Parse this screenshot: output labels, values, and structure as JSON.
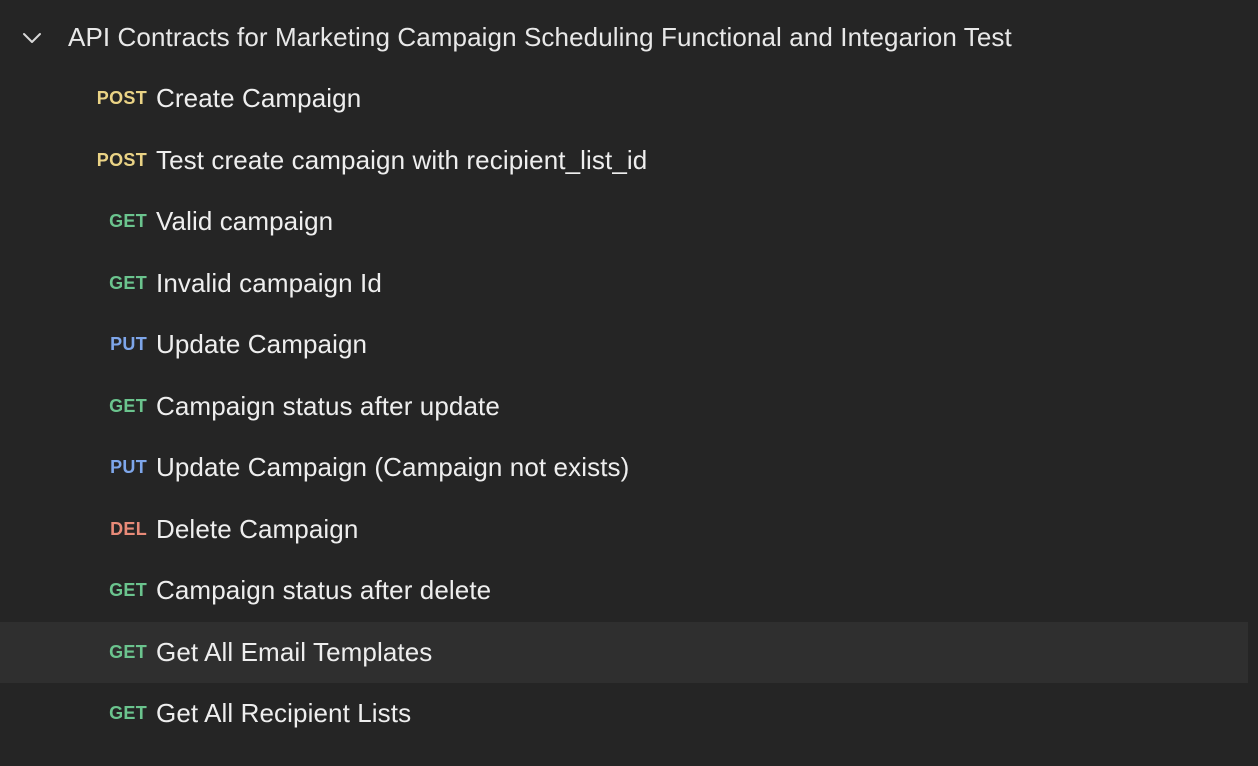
{
  "folder": {
    "title": "API Contracts for Marketing Campaign Scheduling Functional and Integarion Test",
    "expanded": true,
    "chevron_icon": "chevron-down-icon"
  },
  "requests": [
    {
      "method": "POST",
      "name": "Create Campaign"
    },
    {
      "method": "POST",
      "name": "Test create campaign with recipient_list_id"
    },
    {
      "method": "GET",
      "name": "Valid campaign"
    },
    {
      "method": "GET",
      "name": "Invalid campaign Id"
    },
    {
      "method": "PUT",
      "name": "Update Campaign"
    },
    {
      "method": "GET",
      "name": "Campaign status after update"
    },
    {
      "method": "PUT",
      "name": "Update Campaign (Campaign not exists)"
    },
    {
      "method": "DEL",
      "name": "Delete Campaign"
    },
    {
      "method": "GET",
      "name": "Campaign status after delete"
    },
    {
      "method": "GET",
      "name": "Get All Email Templates"
    },
    {
      "method": "GET",
      "name": "Get All Recipient Lists"
    }
  ],
  "colors": {
    "background": "#252525",
    "hover_row": "#2f2f2f",
    "post": "#ead385",
    "get": "#6bc48e",
    "put": "#7ea6ea",
    "del": "#e88a78"
  }
}
